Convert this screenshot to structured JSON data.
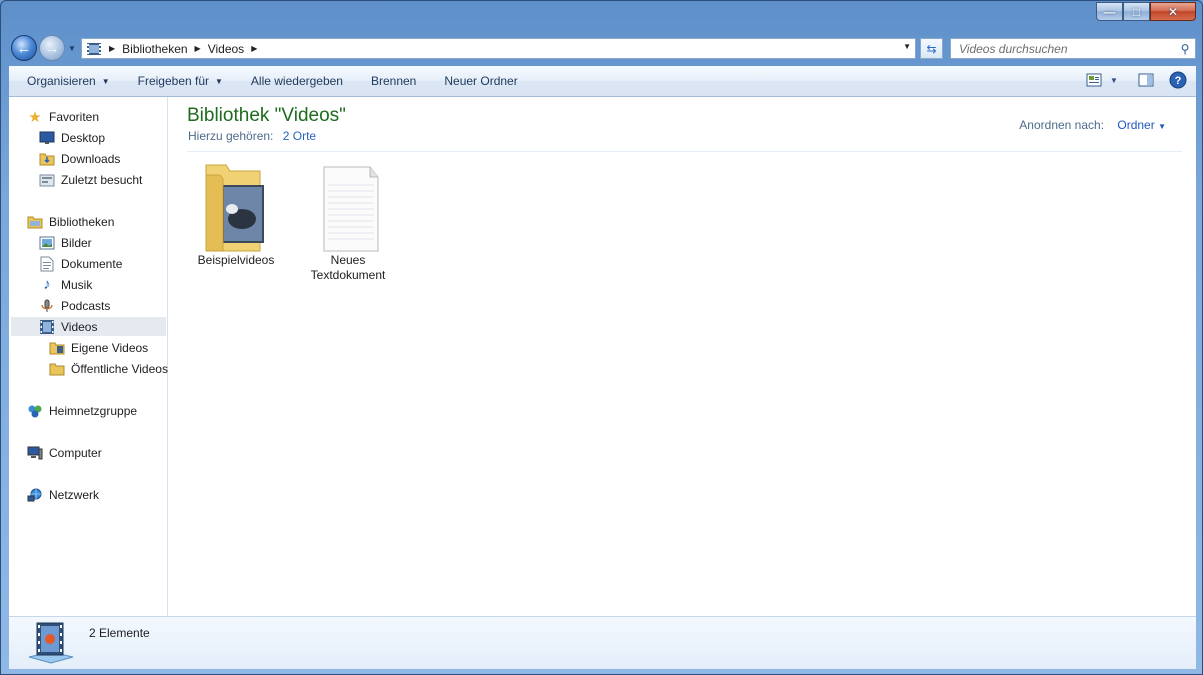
{
  "window": {
    "caption_buttons": {
      "minimize_icon": "minimize-icon",
      "maximize_icon": "maximize-icon",
      "close_icon": "close-icon"
    }
  },
  "address_bar": {
    "segments": [
      "Bibliotheken",
      "Videos"
    ],
    "search_placeholder": "Videos durchsuchen"
  },
  "toolbar": {
    "organize_label": "Organisieren",
    "share_label": "Freigeben für",
    "play_all_label": "Alle wiedergeben",
    "burn_label": "Brennen",
    "new_folder_label": "Neuer Ordner"
  },
  "sidebar": {
    "favorites": {
      "label": "Favoriten",
      "items": [
        "Desktop",
        "Downloads",
        "Zuletzt besucht"
      ]
    },
    "libraries": {
      "label": "Bibliotheken",
      "items": [
        "Bilder",
        "Dokumente",
        "Musik",
        "Podcasts",
        "Videos"
      ]
    },
    "videos_children": [
      "Eigene Videos",
      "Öffentliche Videos"
    ],
    "homegroup": "Heimnetzgruppe",
    "computer": "Computer",
    "network": "Netzwerk",
    "selected": "Videos"
  },
  "main": {
    "title": "Bibliothek \"Videos\"",
    "subtitle_prefix": "Hierzu gehören:",
    "subtitle_link": "2 Orte",
    "arrange_label": "Anordnen nach:",
    "arrange_value": "Ordner",
    "files": [
      {
        "name": "Beispielvideos",
        "type": "folder"
      },
      {
        "name": "Neues Textdokument",
        "type": "text"
      }
    ]
  },
  "status": {
    "count": "2 Elemente"
  }
}
